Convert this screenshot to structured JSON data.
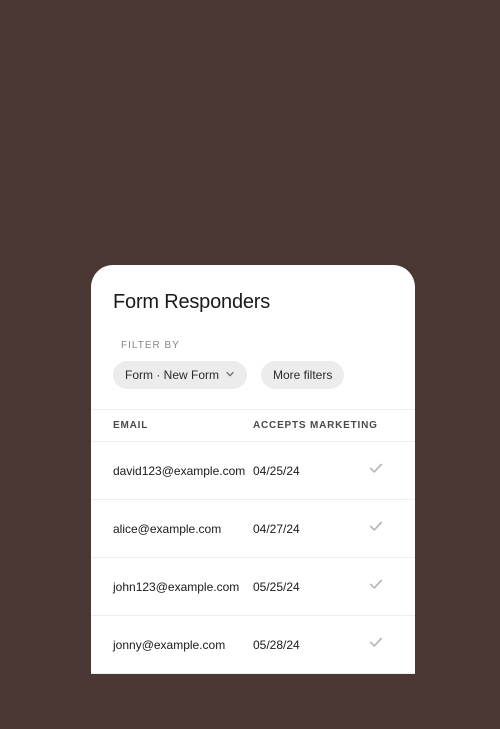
{
  "title": "Form Responders",
  "filter": {
    "label": "FILTER BY",
    "formChip": "Form · New Form",
    "moreFilters": "More filters"
  },
  "headers": {
    "email": "EMAIL",
    "accepts": "ACCEPTS MARKETING"
  },
  "rows": [
    {
      "email": "david123@example.com",
      "date": "04/25/24",
      "accepts": true
    },
    {
      "email": "alice@example.com",
      "date": "04/27/24",
      "accepts": true
    },
    {
      "email": "john123@example.com",
      "date": "05/25/24",
      "accepts": true
    },
    {
      "email": "jonny@example.com",
      "date": "05/28/24",
      "accepts": true
    }
  ]
}
